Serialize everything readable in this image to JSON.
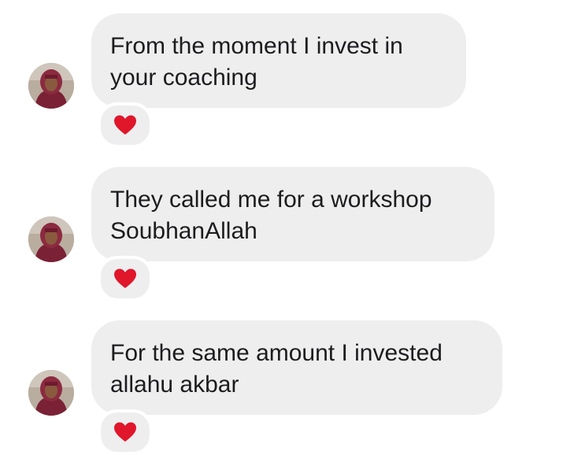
{
  "colors": {
    "bubble_bg": "#eeeeef",
    "text": "#1c1c1e",
    "heart": "#e0162b"
  },
  "messages": [
    {
      "lines": [
        "From the moment I invest in",
        "your coaching"
      ],
      "reaction": "heart-icon"
    },
    {
      "lines": [
        "They called me for a workshop",
        "SoubhanAllah"
      ],
      "reaction": "heart-icon"
    },
    {
      "lines": [
        "For the same amount I invested",
        "allahu akbar"
      ],
      "reaction": "heart-icon"
    }
  ]
}
